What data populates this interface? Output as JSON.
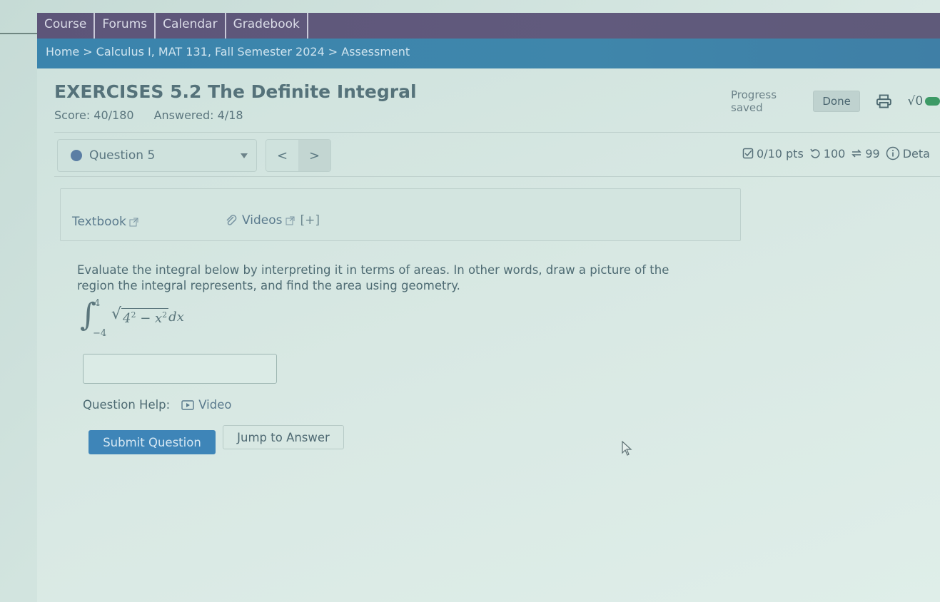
{
  "nav": {
    "tabs": [
      {
        "label": "Course"
      },
      {
        "label": "Forums"
      },
      {
        "label": "Calendar"
      },
      {
        "label": "Gradebook"
      }
    ]
  },
  "breadcrumb": {
    "items": [
      "Home",
      "Calculus I, MAT 131, Fall Semester 2024",
      "Assessment"
    ],
    "separator": ">"
  },
  "assessment": {
    "title": "EXERCISES 5.2 The Definite Integral",
    "score": "Score: 40/180",
    "answered": "Answered: 4/18",
    "progress_status": "Progress saved",
    "done_label": "Done",
    "print_icon": "printer-icon",
    "math_toggle_label": "√0"
  },
  "question_bar": {
    "selected_question": "Question 5",
    "prev_label": "<",
    "next_label": ">",
    "points": "0/10 pts",
    "retries": "100",
    "attempts": "99",
    "details_label": "Deta"
  },
  "resources": {
    "textbook_label": "Textbook",
    "videos_label": "Videos",
    "expand_label": "[+]"
  },
  "question": {
    "prompt": "Evaluate the integral below by interpreting it in terms of areas. In other words, draw a picture of the region the integral represents, and find the area using geometry.",
    "integral": {
      "upper": "4",
      "lower": "−4",
      "radicand_base": "4",
      "radicand_exp": "2",
      "minus": " − ",
      "var": "x",
      "var_exp": "2",
      "differential": "dx"
    },
    "answer_value": "",
    "help_label": "Question Help:",
    "help_video_label": "Video",
    "submit_label": "Submit Question",
    "jump_label": "Jump to Answer"
  },
  "colors": {
    "nav_bg": "#5d5579",
    "breadcrumb_bg": "#3a84ad",
    "submit_bg": "#3e85b8",
    "toggle_on": "#3d9a66"
  }
}
